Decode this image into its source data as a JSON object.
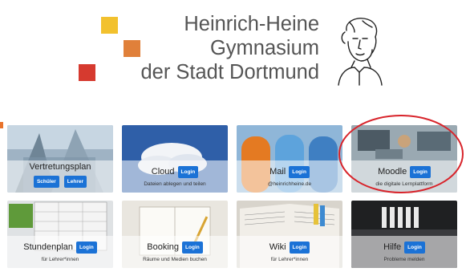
{
  "header": {
    "line1": "Heinrich-Heine",
    "line2": "Gymnasium",
    "line3": "der Stadt Dortmund"
  },
  "colors": {
    "logo_yellow": "#f2c12e",
    "logo_orange": "#e0803a",
    "logo_red": "#d63a2f",
    "button_blue": "#1b72d6",
    "highlight_red": "#d8242b"
  },
  "tiles": [
    {
      "title": "Vertretungsplan",
      "buttons": [
        "Schüler",
        "Lehrer"
      ],
      "subtitle": ""
    },
    {
      "title": "Cloud",
      "buttons": [
        "Login"
      ],
      "subtitle": "Dateien ablegen und teilen"
    },
    {
      "title": "Mail",
      "buttons": [
        "Login"
      ],
      "subtitle": "@heinrichheine.de"
    },
    {
      "title": "Moodle",
      "buttons": [
        "Login"
      ],
      "subtitle": "die digitale Lernplattform"
    },
    {
      "title": "Stundenplan",
      "buttons": [
        "Login"
      ],
      "subtitle": "für Lehrer*innen"
    },
    {
      "title": "Booking",
      "buttons": [
        "Login"
      ],
      "subtitle": "Räume und Medien buchen"
    },
    {
      "title": "Wiki",
      "buttons": [
        "Login"
      ],
      "subtitle": "für Lehrer*innen"
    },
    {
      "title": "Hilfe",
      "buttons": [
        "Login"
      ],
      "subtitle": "Probleme melden"
    }
  ]
}
